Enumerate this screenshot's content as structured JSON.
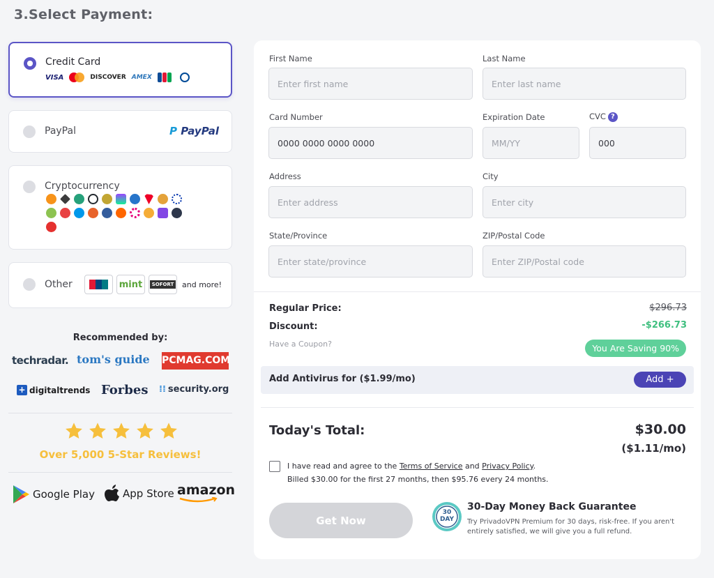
{
  "page": {
    "title": "3.Select Payment:"
  },
  "payment_methods": {
    "credit_card": {
      "label": "Credit Card",
      "card_brands": [
        "VISA",
        "DISCOVER",
        "AMEX",
        "JCB"
      ]
    },
    "paypal": {
      "label": "PayPal",
      "logo_text": "PayPal"
    },
    "crypto": {
      "label": "Cryptocurrency"
    },
    "other": {
      "label": "Other",
      "logos": [
        "mint",
        "SOFORT"
      ],
      "and_more": "and more!"
    }
  },
  "recommended": {
    "title": "Recommended by:",
    "press": [
      "techradar.",
      "tom's guide",
      "PCMAG.COM",
      "digitaltrends",
      "Forbes",
      "security.org"
    ],
    "reviews": "Over 5,000 5-Star Reviews!",
    "stores": [
      "Google Play",
      "App Store",
      "amazon"
    ]
  },
  "form": {
    "first_name": {
      "label": "First Name",
      "placeholder": "Enter first name"
    },
    "last_name": {
      "label": "Last Name",
      "placeholder": "Enter last name"
    },
    "card_number": {
      "label": "Card Number",
      "placeholder": "0000 0000 0000 0000"
    },
    "expiration": {
      "label": "Expiration Date",
      "placeholder": "MM/YY"
    },
    "cvc": {
      "label": "CVC",
      "placeholder": "000",
      "help": "?"
    },
    "address": {
      "label": "Address",
      "placeholder": "Enter address"
    },
    "city": {
      "label": "City",
      "placeholder": "Enter city"
    },
    "state": {
      "label": "State/Province",
      "placeholder": "Enter state/province"
    },
    "zip": {
      "label": "ZIP/Postal Code",
      "placeholder": "Enter ZIP/Postal code"
    }
  },
  "pricing": {
    "regular_label": "Regular Price:",
    "regular_value": "$296.73",
    "discount_label": "Discount:",
    "discount_value": "-$266.73",
    "coupon": "Have a Coupon?",
    "saving": "You Are Saving 90%",
    "antivirus": "Add Antivirus for ($1.99/mo)",
    "add_button": "Add +",
    "total_label": "Today's Total:",
    "total_value": "$30.00",
    "total_monthly": "($1.11/mo)"
  },
  "agreement": {
    "prefix": "I have read and agree to the ",
    "terms": "Terms of Service",
    "and": " and ",
    "privacy": "Privacy Policy",
    "suffix": ".",
    "billing": "Billed $30.00 for the first 27 months, then $95.76 every 24 months."
  },
  "cta": {
    "get_now": "Get Now"
  },
  "guarantee": {
    "badge_num": "30",
    "badge_unit": "DAY",
    "title": "30-Day Money Back Guarantee",
    "text": "Try PrivadoVPN Premium for 30 days, risk-free. If you aren't entirely satisfied, we will give you a full refund."
  },
  "colors": {
    "accent": "#5b55c6",
    "saving_green": "#5fd09a",
    "stars": "#f6bf3c",
    "discount_green": "#3fbf7f"
  }
}
